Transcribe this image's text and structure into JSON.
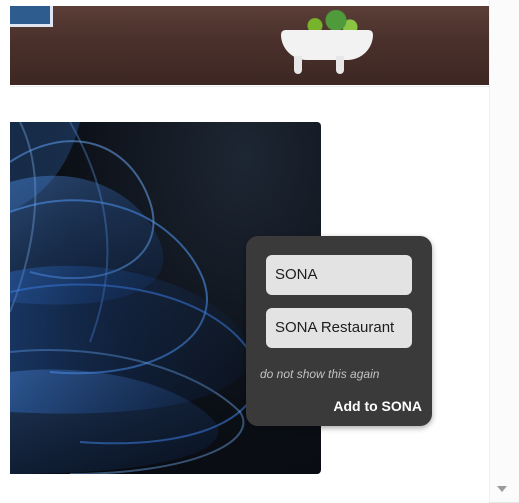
{
  "popup": {
    "options": [
      "SONA",
      "SONA Restaurant"
    ],
    "dismiss_label": "do not show this again",
    "add_label": "Add to SONA"
  },
  "colors": {
    "popup_bg": "#3a3a3a",
    "option_bg": "#e3e3e3",
    "image_accent": "#2f73d6"
  },
  "icons": {
    "scroll_down": "scroll-down-arrow-icon"
  }
}
